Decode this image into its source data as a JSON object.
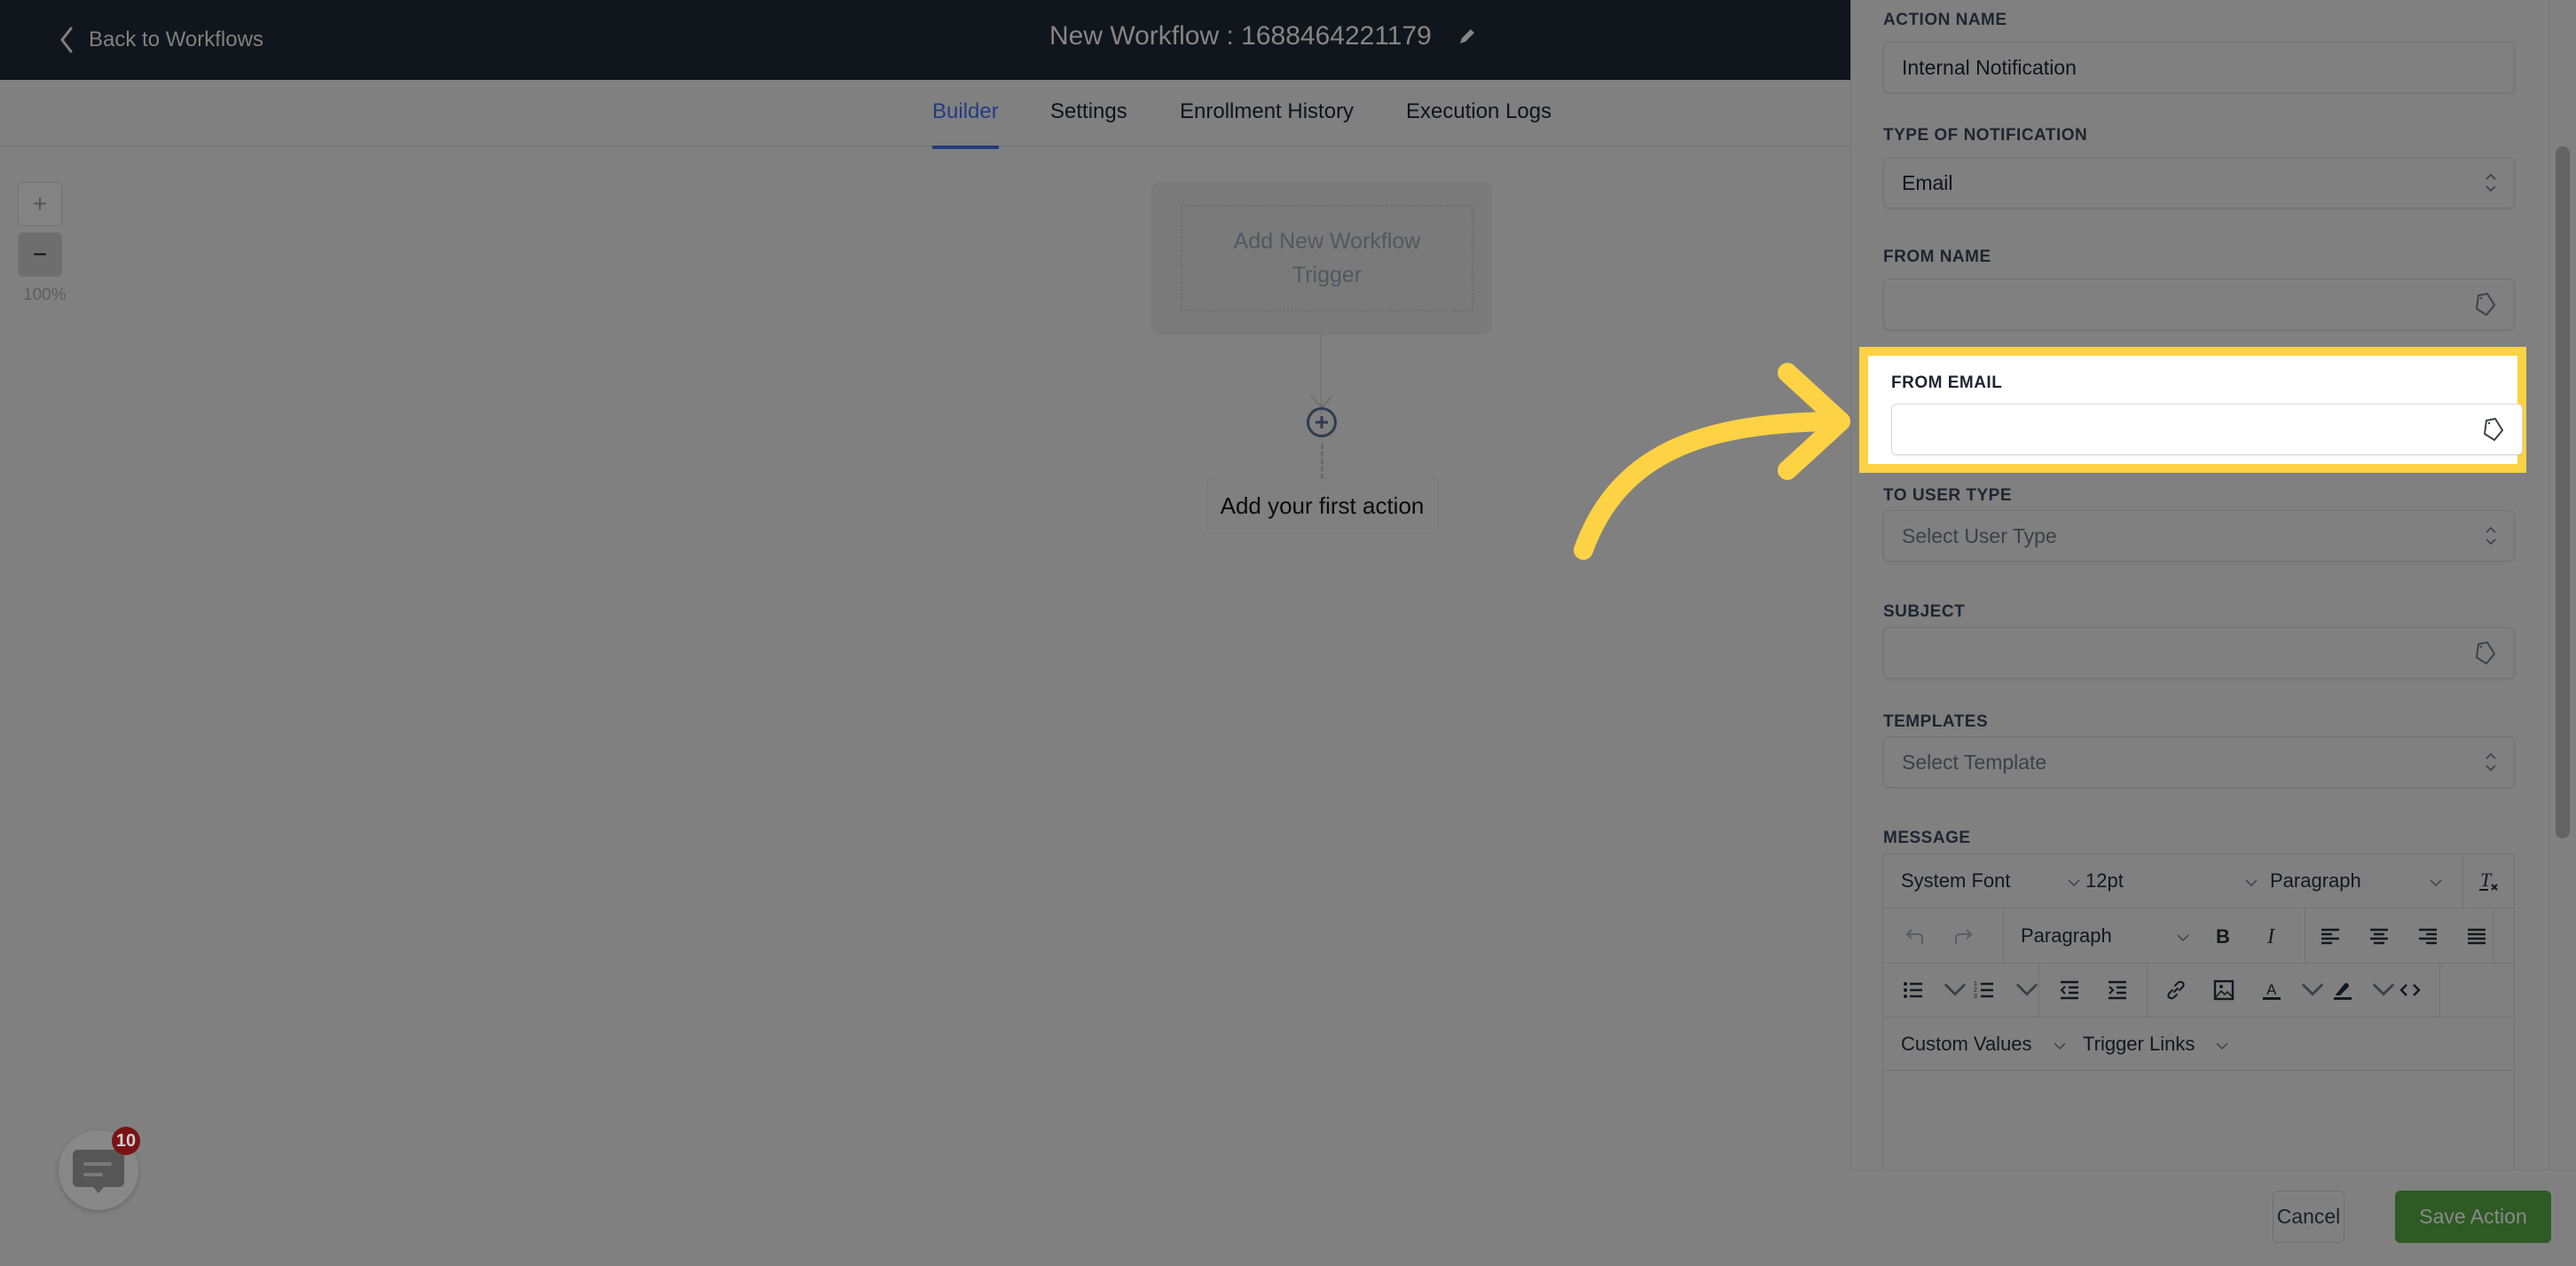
{
  "header": {
    "back_label": "Back to Workflows",
    "workflow_title": "New Workflow : 1688464221179"
  },
  "tabs": [
    {
      "label": "Builder",
      "active": true
    },
    {
      "label": "Settings",
      "active": false
    },
    {
      "label": "Enrollment History",
      "active": false
    },
    {
      "label": "Execution Logs",
      "active": false
    }
  ],
  "canvas": {
    "zoom_in_label": "+",
    "zoom_out_label": "−",
    "zoom_level": "100%",
    "trigger_label": "Add New Workflow Trigger",
    "first_action_label": "Add your first action"
  },
  "chat": {
    "badge_count": "10"
  },
  "panel": {
    "fields": {
      "action_name": {
        "label": "ACTION NAME",
        "value": "Internal Notification"
      },
      "notification_type": {
        "label": "TYPE OF NOTIFICATION",
        "value": "Email"
      },
      "from_name": {
        "label": "FROM NAME",
        "value": ""
      },
      "from_email": {
        "label": "FROM EMAIL",
        "value": ""
      },
      "to_user_type": {
        "label": "TO USER TYPE",
        "placeholder": "Select User Type"
      },
      "subject": {
        "label": "SUBJECT",
        "value": ""
      },
      "templates": {
        "label": "TEMPLATES",
        "placeholder": "Select Template"
      },
      "message": {
        "label": "MESSAGE"
      }
    },
    "editor": {
      "font_family": "System Font",
      "font_size": "12pt",
      "block_format": "Paragraph",
      "block_format_2": "Paragraph",
      "custom_values_label": "Custom Values",
      "trigger_links_label": "Trigger Links"
    },
    "cancel_label": "Cancel",
    "save_label": "Save Action"
  },
  "colors": {
    "highlight": "#fdd245",
    "active_tab": "#243b80",
    "save_button": "#2e5a23",
    "badge": "#7a1414"
  }
}
